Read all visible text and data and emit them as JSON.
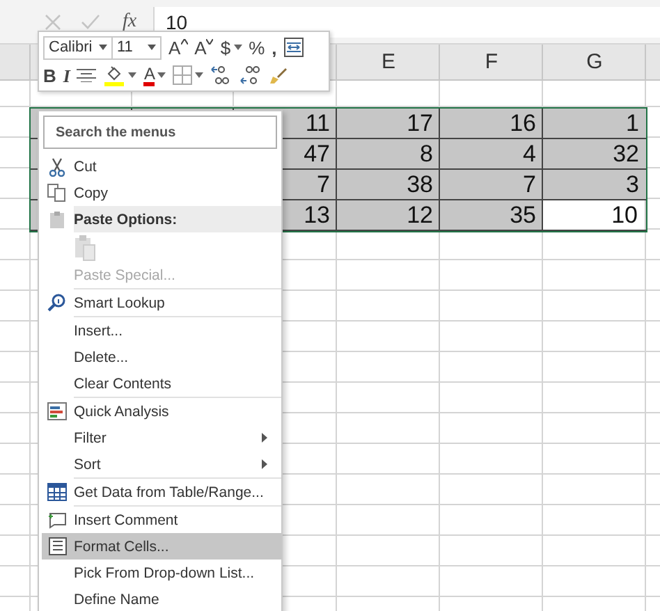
{
  "formula_bar": {
    "fx": "fx",
    "value": "10"
  },
  "mini_toolbar": {
    "font": "Calibri",
    "size": "11",
    "row1": [
      {
        "kind": "grow",
        "label": "A"
      },
      {
        "kind": "shrink",
        "label": "A"
      },
      {
        "kind": "currency",
        "label": "$"
      },
      {
        "kind": "percent",
        "label": "%"
      },
      {
        "kind": "comma",
        "label": ","
      },
      {
        "kind": "wrap"
      }
    ],
    "row2": [
      {
        "kind": "bold",
        "label": "B"
      },
      {
        "kind": "italic",
        "label": "I"
      },
      {
        "kind": "align"
      },
      {
        "kind": "fill"
      },
      {
        "kind": "fontcolor",
        "label": "A"
      },
      {
        "kind": "borders"
      },
      {
        "kind": "incdec"
      },
      {
        "kind": "decdec"
      },
      {
        "kind": "painter"
      }
    ]
  },
  "columns": [
    "E",
    "F",
    "G"
  ],
  "rows": [
    {
      "cells": [
        {
          "value": "11",
          "active": false
        },
        {
          "value": "17",
          "active": false
        },
        {
          "value": "16",
          "active": false
        },
        {
          "value": "1",
          "active": false
        }
      ]
    },
    {
      "cells": [
        {
          "value": "47",
          "active": false
        },
        {
          "value": "8",
          "active": false
        },
        {
          "value": "4",
          "active": false
        },
        {
          "value": "32",
          "active": false
        }
      ]
    },
    {
      "cells": [
        {
          "value": "7",
          "active": false
        },
        {
          "value": "38",
          "active": false
        },
        {
          "value": "7",
          "active": false
        },
        {
          "value": "3",
          "active": false
        }
      ]
    },
    {
      "cells": [
        {
          "value": "13",
          "active": false
        },
        {
          "value": "12",
          "active": false
        },
        {
          "value": "35",
          "active": false
        },
        {
          "value": "10",
          "active": true
        }
      ]
    }
  ],
  "context_menu": {
    "search_placeholder": "Search the menus",
    "items": [
      {
        "kind": "item",
        "label": "Cut",
        "disabled": false,
        "submenu": false,
        "selected": false
      },
      {
        "kind": "item",
        "label": "Copy",
        "disabled": false,
        "submenu": false,
        "selected": false
      },
      {
        "kind": "header",
        "label": "Paste Options:"
      },
      {
        "kind": "paste"
      },
      {
        "kind": "item",
        "label": "Paste Special...",
        "disabled": true,
        "submenu": false,
        "selected": false
      },
      {
        "kind": "separator"
      },
      {
        "kind": "item",
        "label": "Smart Lookup",
        "disabled": false,
        "submenu": false,
        "selected": false
      },
      {
        "kind": "separator"
      },
      {
        "kind": "item",
        "label": "Insert...",
        "disabled": false,
        "submenu": false,
        "selected": false
      },
      {
        "kind": "item",
        "label": "Delete...",
        "disabled": false,
        "submenu": false,
        "selected": false
      },
      {
        "kind": "item",
        "label": "Clear Contents",
        "disabled": false,
        "submenu": false,
        "selected": false
      },
      {
        "kind": "separator"
      },
      {
        "kind": "item",
        "label": "Quick Analysis",
        "disabled": false,
        "submenu": false,
        "selected": false
      },
      {
        "kind": "item",
        "label": "Filter",
        "disabled": false,
        "submenu": true,
        "selected": false
      },
      {
        "kind": "item",
        "label": "Sort",
        "disabled": false,
        "submenu": true,
        "selected": false
      },
      {
        "kind": "separator"
      },
      {
        "kind": "item",
        "label": "Get Data from Table/Range...",
        "disabled": false,
        "submenu": false,
        "selected": false
      },
      {
        "kind": "separator"
      },
      {
        "kind": "item",
        "label": "Insert Comment",
        "disabled": false,
        "submenu": false,
        "selected": false
      },
      {
        "kind": "item",
        "label": "Format Cells...",
        "disabled": false,
        "submenu": false,
        "selected": true
      },
      {
        "kind": "item",
        "label": "Pick From Drop-down List...",
        "disabled": false,
        "submenu": false,
        "selected": false
      },
      {
        "kind": "item",
        "label": "Define Name",
        "disabled": false,
        "submenu": false,
        "selected": false
      }
    ]
  }
}
